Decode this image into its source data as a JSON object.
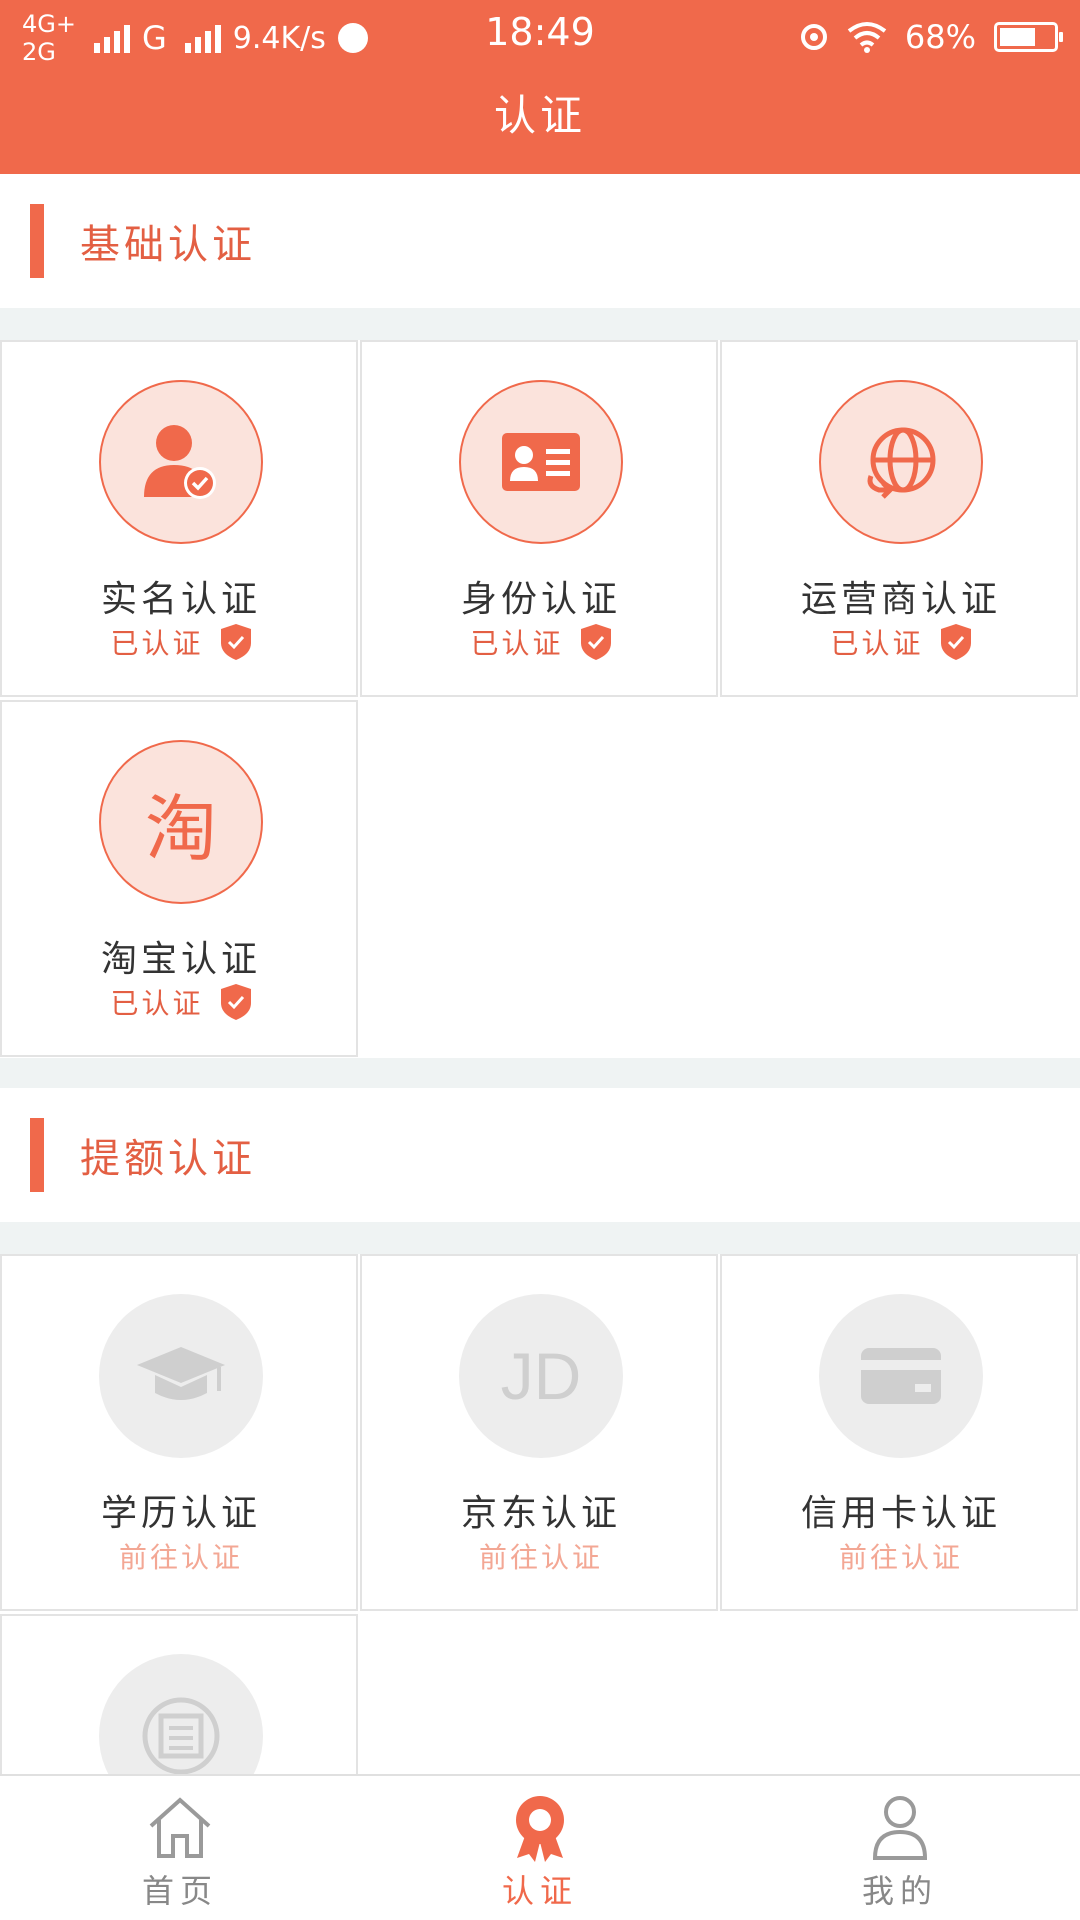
{
  "status_bar": {
    "network_top": "4G+",
    "network_bottom": "2G",
    "network_g": "G",
    "speed": "9.4K/s",
    "time": "18:49",
    "battery": "68%",
    "battery_level": 0.68
  },
  "header": {
    "title": "认证"
  },
  "colors": {
    "accent": "#f0694b",
    "inactive_gray": "#cfcfcf",
    "todo_text": "#f3a794"
  },
  "basic_section": {
    "title": "基础认证",
    "items": [
      {
        "title": "实名认证",
        "status": "已认证",
        "icon": "person-verified-icon"
      },
      {
        "title": "身份认证",
        "status": "已认证",
        "icon": "id-card-icon"
      },
      {
        "title": "运营商认证",
        "status": "已认证",
        "icon": "globe-icon"
      },
      {
        "title": "淘宝认证",
        "status": "已认证",
        "icon": "taobao-icon",
        "icon_text": "淘"
      }
    ]
  },
  "quota_section": {
    "title": "提额认证",
    "items": [
      {
        "title": "学历认证",
        "status": "前往认证",
        "icon": "graduation-cap-icon"
      },
      {
        "title": "京东认证",
        "status": "前往认证",
        "icon": "jd-icon",
        "icon_text": "JD"
      },
      {
        "title": "信用卡认证",
        "status": "前往认证",
        "icon": "credit-card-icon"
      },
      {
        "icon": "credit-report-icon"
      }
    ]
  },
  "tabbar": {
    "items": [
      {
        "label": "首页",
        "icon": "home-icon",
        "active": false
      },
      {
        "label": "认证",
        "icon": "badge-icon",
        "active": true
      },
      {
        "label": "我的",
        "icon": "user-icon",
        "active": false
      }
    ]
  }
}
